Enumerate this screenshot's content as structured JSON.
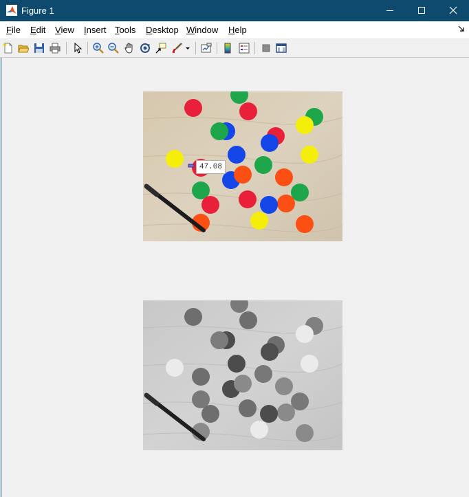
{
  "window": {
    "title": "Figure 1"
  },
  "menu": {
    "items": [
      {
        "key": "file",
        "underline": "F",
        "rest": "ile"
      },
      {
        "key": "edit",
        "underline": "E",
        "rest": "dit"
      },
      {
        "key": "view",
        "underline": "V",
        "rest": "iew"
      },
      {
        "key": "insert",
        "underline": "I",
        "rest": "nsert"
      },
      {
        "key": "tools",
        "underline": "T",
        "rest": "ools"
      },
      {
        "key": "desktop",
        "underline": "D",
        "rest": "esktop"
      },
      {
        "key": "window",
        "underline": "W",
        "rest": "indow"
      },
      {
        "key": "help",
        "underline": "H",
        "rest": "elp"
      }
    ]
  },
  "toolbar": {
    "icons": [
      "new-figure-icon",
      "open-file-icon",
      "save-icon",
      "print-icon",
      "pointer-icon",
      "zoom-in-icon",
      "zoom-out-icon",
      "pan-icon",
      "rotate-3d-icon",
      "data-cursor-icon",
      "brush-icon",
      "brush-dropdown-icon",
      "link-plot-icon",
      "colorbar-icon",
      "legend-icon",
      "hide-plot-tools-icon",
      "show-plot-tools-icon"
    ]
  },
  "datatip": {
    "value": "47.08"
  },
  "colors": {
    "titlebar": "#0d4a6e",
    "red": "#e8203a",
    "green": "#1ea64a",
    "blue": "#1546e8",
    "yellow": "#f5ee0a",
    "orange": "#fb4f14",
    "wood": "#d9cdb8"
  }
}
